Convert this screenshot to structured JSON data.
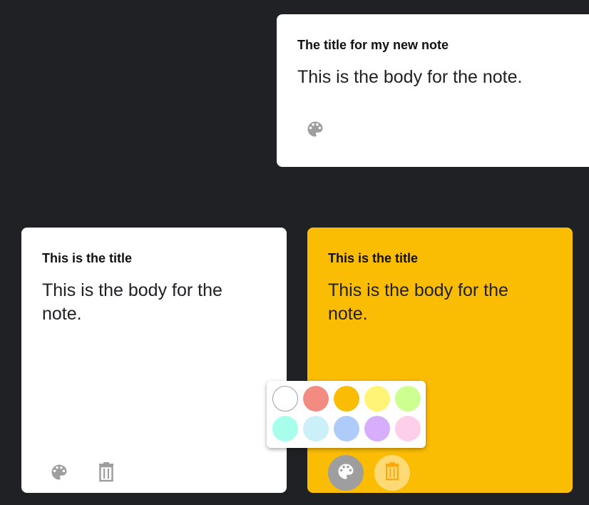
{
  "colors": {
    "background": "#202124",
    "note_default": "#ffffff",
    "note_yellow": "#fbbc04",
    "icon_gray": "#9e9e9e"
  },
  "new_note": {
    "title": "The title for my new note",
    "body": "This is the body for the note.",
    "palette_icon": "palette-icon"
  },
  "notes": [
    {
      "title": "This is the title",
      "body": "This is the body for the note.",
      "color": "#ffffff",
      "palette_icon": "palette-icon",
      "delete_icon": "trash-icon"
    },
    {
      "title": "This is the title",
      "body": "This is the body for the note.",
      "color": "#fbbc04",
      "palette_icon": "palette-icon",
      "delete_icon": "trash-icon"
    }
  ],
  "color_picker": {
    "swatches": [
      {
        "name": "default",
        "color": "#ffffff"
      },
      {
        "name": "red",
        "color": "#f28b82"
      },
      {
        "name": "orange",
        "color": "#fbbc04"
      },
      {
        "name": "yellow",
        "color": "#fff475"
      },
      {
        "name": "green",
        "color": "#ccff90"
      },
      {
        "name": "teal",
        "color": "#a7ffeb"
      },
      {
        "name": "light-blue",
        "color": "#cbf0f8"
      },
      {
        "name": "blue",
        "color": "#aecbfa"
      },
      {
        "name": "purple",
        "color": "#d7aefb"
      },
      {
        "name": "pink",
        "color": "#fdcfe8"
      }
    ]
  }
}
